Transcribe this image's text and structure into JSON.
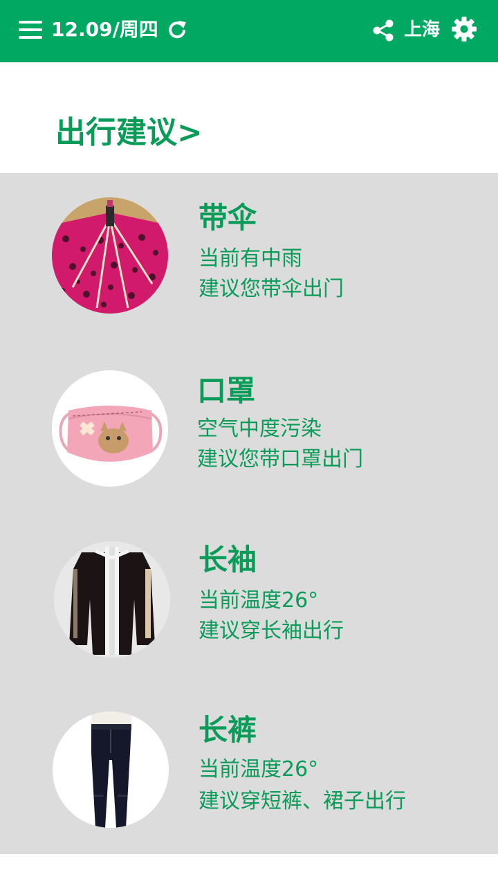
{
  "top_bar": {
    "date_text": "12.09/周四",
    "city_text": "上海",
    "icons": [
      "menu-icon",
      "refresh-icon",
      "share-icon",
      "gear-icon"
    ],
    "background_color": "#00a862"
  },
  "header": {
    "title": "出行建议>"
  },
  "suggestions": [
    {
      "title": "带伞",
      "line1": "当前有中雨",
      "line2": "建议您带伞出门",
      "image": "umbrella-image"
    },
    {
      "title": "口罩",
      "line1": "空气中度污染",
      "line2": "建议您带口罩出门",
      "image": "mask-image"
    },
    {
      "title": "长袖",
      "line1": "当前温度26°",
      "line2": "建议穿长袖出行",
      "image": "long-sleeve-shirt-image"
    },
    {
      "title": "长裤",
      "line1": "当前温度26°",
      "line2": "建议穿短裤、裙子出行",
      "image": "long-pants-image"
    }
  ],
  "colors": {
    "accent_green": "#00a862",
    "text_green": "#0a9b59",
    "list_background": "#dcdcdc"
  }
}
